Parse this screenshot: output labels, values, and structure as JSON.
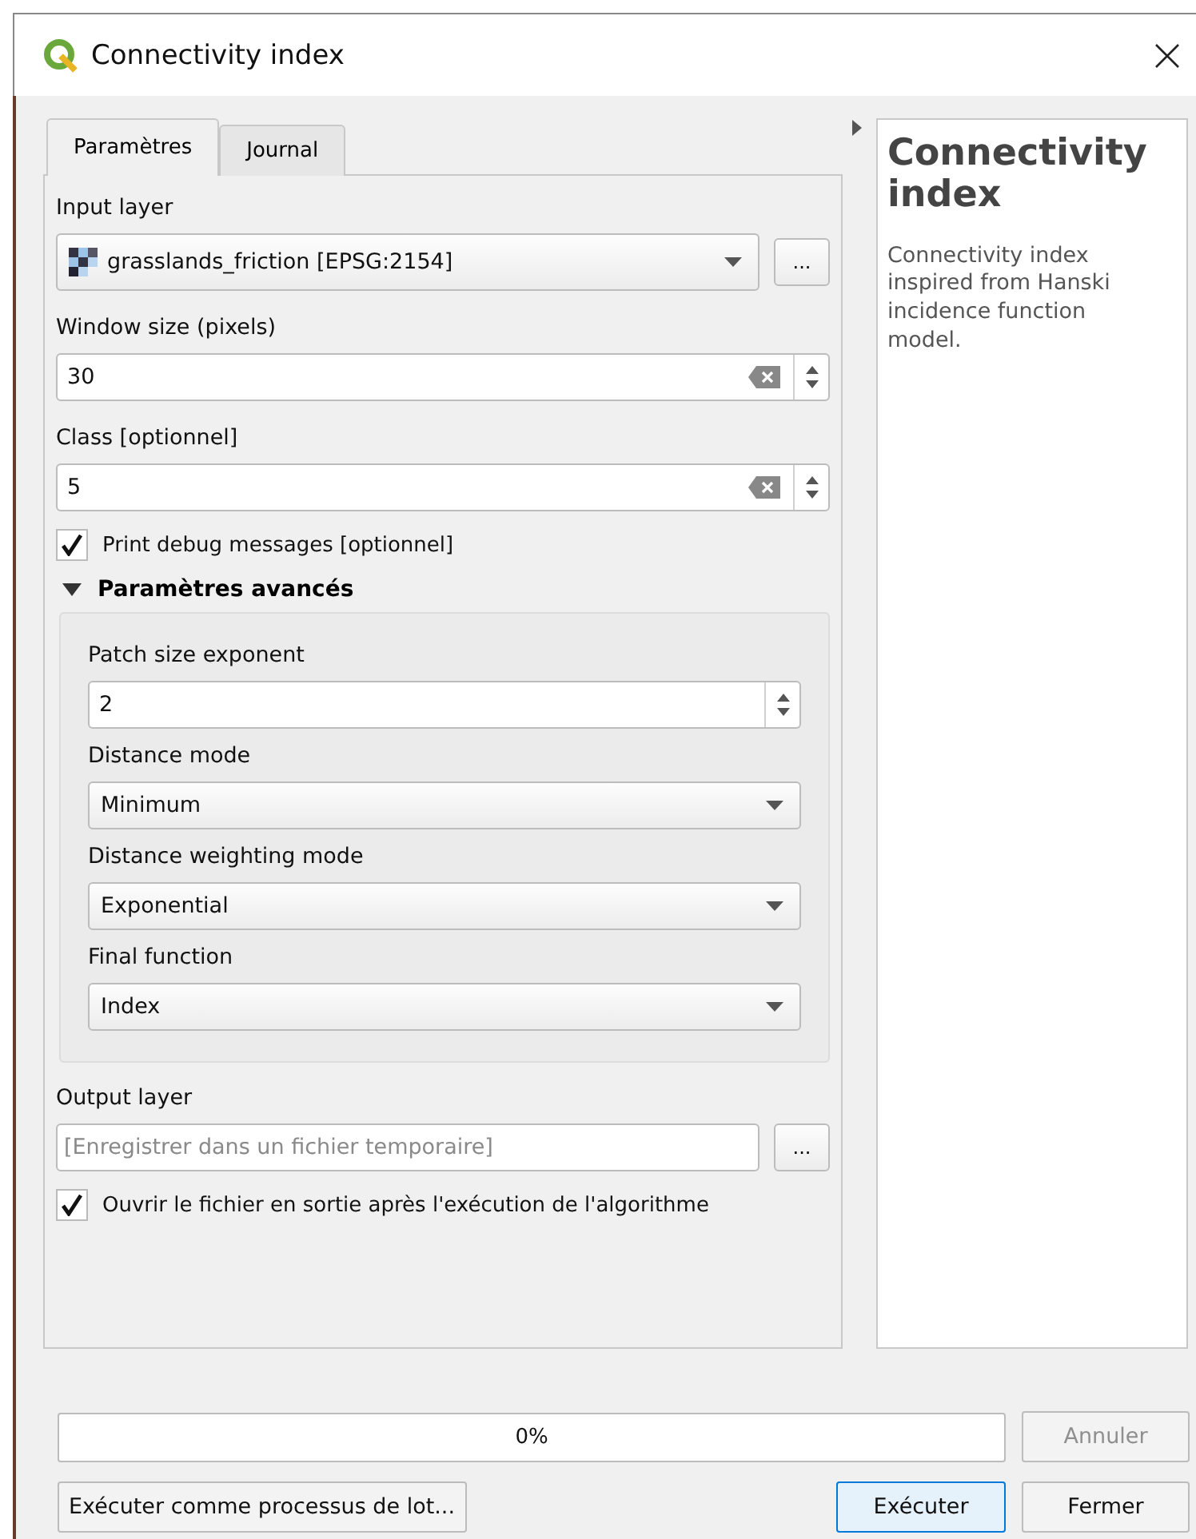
{
  "window": {
    "title": "Connectivity index"
  },
  "tabs": [
    {
      "label": "Paramètres",
      "selected": true
    },
    {
      "label": "Journal",
      "selected": false
    }
  ],
  "parameters": [
    {
      "kind": "layer",
      "label": "Input layer",
      "value": "grasslands_friction [EPSG:2154]",
      "button": "..."
    },
    {
      "kind": "spin",
      "label": "Window size (pixels)",
      "value": "30",
      "clearable": true
    },
    {
      "kind": "spin",
      "label": "Class [optionnel]",
      "value": "5",
      "clearable": true
    },
    {
      "kind": "checkbox",
      "label": "Print debug messages [optionnel]",
      "checked": true
    },
    {
      "kind": "group",
      "label": "Paramètres avancés",
      "expanded": true,
      "children": [
        {
          "kind": "spin",
          "label": "Patch size exponent",
          "value": "2",
          "clearable": false
        },
        {
          "kind": "combo",
          "label": "Distance mode",
          "value": "Minimum"
        },
        {
          "kind": "combo",
          "label": "Distance weighting mode",
          "value": "Exponential"
        },
        {
          "kind": "combo",
          "label": "Final function",
          "value": "Index"
        }
      ]
    },
    {
      "kind": "output",
      "label": "Output layer",
      "placeholder": "[Enregistrer dans un fichier temporaire]",
      "button": "..."
    },
    {
      "kind": "checkbox",
      "label": "Ouvrir le fichier en sortie après l'exécution de l'algorithme",
      "checked": true
    }
  ],
  "help": {
    "title": "Connectivity index",
    "description": "Connectivity index inspired from Hanski incidence function model."
  },
  "progress": {
    "text": "0%",
    "level": 0
  },
  "cancel_button": {
    "label": "Annuler",
    "disabled": true
  },
  "batch_button": "Exécuter comme processus de lot...",
  "run_button": {
    "label": "Exécuter",
    "selected": true
  },
  "close_button": "Fermer"
}
